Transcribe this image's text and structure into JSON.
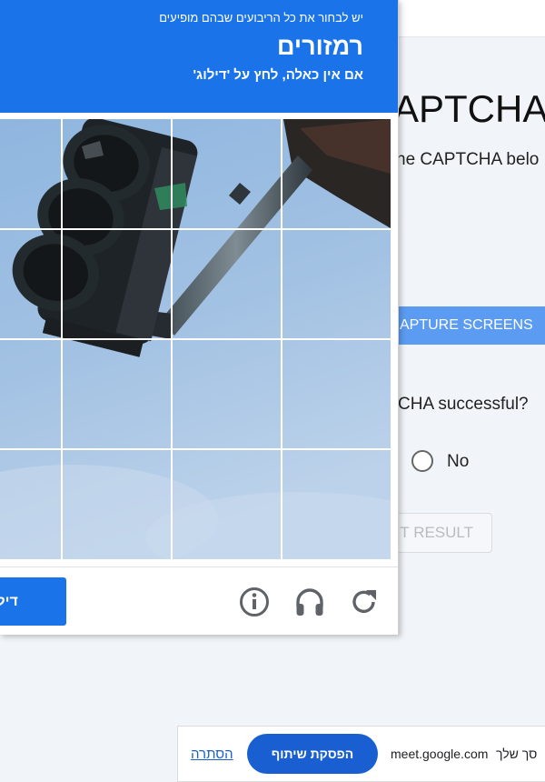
{
  "background_page": {
    "title_fragment": "APTCHA",
    "instruction_fragment": "he CAPTCHA belo",
    "capture_button_fragment": "APTURE SCREENS",
    "question_fragment": "CHA successful?",
    "radio_no_label": "No",
    "submit_fragment": "T RESULT"
  },
  "captcha": {
    "instruction_line": "יש לבחור את כל הריבועים שבהם מופיעים",
    "target_word": "רמזורים",
    "skip_hint": "אם אין כאלה, לחץ על 'דילוג'",
    "image_subject": "traffic light against sky",
    "grid": {
      "rows": 4,
      "cols": 4
    },
    "skip_button_label": "דילוג",
    "icons": [
      "info-icon",
      "headphones-icon",
      "reload-icon"
    ],
    "accent_color": "#1a73e8"
  },
  "share_bar": {
    "hide_link": "הסתרה",
    "stop_sharing_button": "הפסקת שיתוף",
    "domain": "meet.google.com",
    "partial_text": "סך שלך"
  }
}
